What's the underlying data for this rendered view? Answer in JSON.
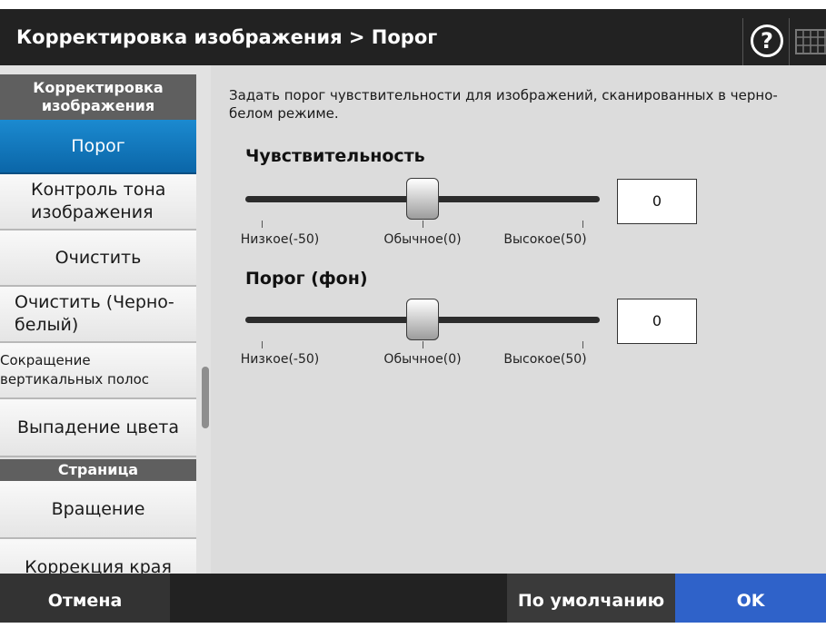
{
  "header": {
    "title": "Корректировка изображения > Порог",
    "help_symbol": "?",
    "keyboard_icon": "keyboard-icon"
  },
  "sidebar": {
    "items": [
      {
        "type": "header",
        "label": "Корректировка изображения"
      },
      {
        "type": "item",
        "label": "Порог",
        "active": true
      },
      {
        "type": "item",
        "label": "Контроль тона изображения"
      },
      {
        "type": "item",
        "label": "Очистить"
      },
      {
        "type": "item",
        "label": "Очистить (Черно-белый)"
      },
      {
        "type": "item",
        "label": "Сокращение вертикальных полос"
      },
      {
        "type": "item",
        "label": "Выпадение цвета"
      },
      {
        "type": "header",
        "label": "Страница"
      },
      {
        "type": "item",
        "label": "Вращение"
      },
      {
        "type": "item",
        "label": "Коррекция края"
      }
    ]
  },
  "main": {
    "description": "Задать порог чувствительности для изображений, сканированных в черно-белом режиме.",
    "sliders": [
      {
        "title": "Чувствительность",
        "value": "0",
        "min": -50,
        "max": 50,
        "current": 0,
        "labels": [
          "Низкое(-50)",
          "Обычное(0)",
          "Высокое(50)"
        ]
      },
      {
        "title": "Порог (фон)",
        "value": "0",
        "min": -50,
        "max": 50,
        "current": 0,
        "labels": [
          "Низкое(-50)",
          "Обычное(0)",
          "Высокое(50)"
        ]
      }
    ]
  },
  "footer": {
    "cancel_label": "Отмена",
    "default_label": "По умолчанию",
    "ok_label": "OK"
  },
  "colors": {
    "title_bar": "#222222",
    "active_item": "#0b66a8",
    "ok_button": "#2f62c9",
    "content_bg": "#dcdcdc"
  }
}
